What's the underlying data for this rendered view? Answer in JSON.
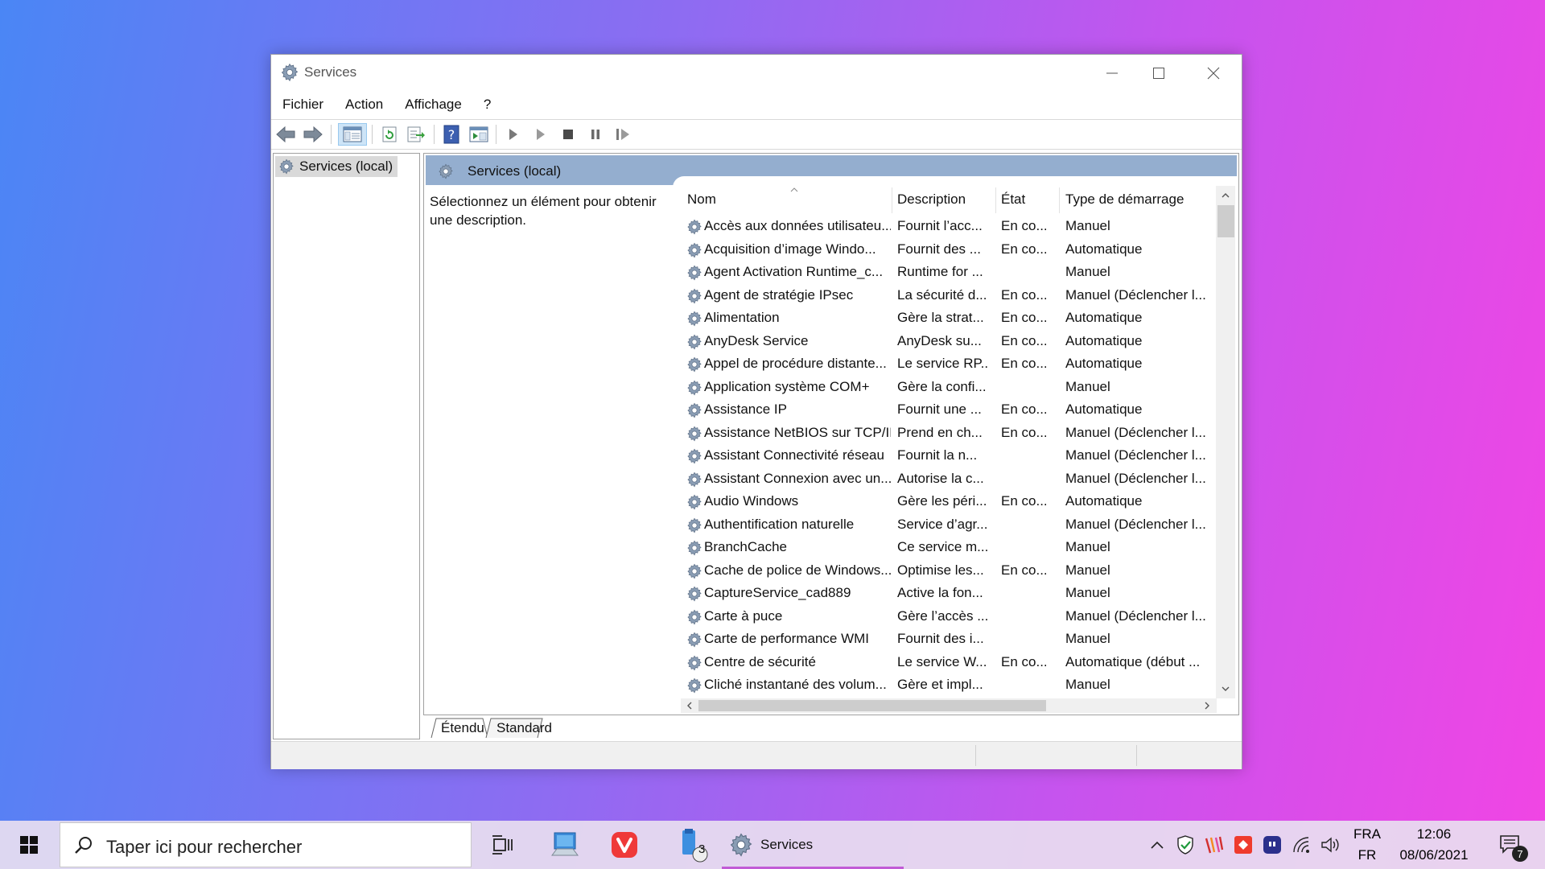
{
  "window": {
    "title": "Services"
  },
  "menu": [
    "Fichier",
    "Action",
    "Affichage",
    "?"
  ],
  "tree": {
    "root_label": "Services (local)"
  },
  "pane": {
    "header": "Services (local)",
    "description_prompt": "Sélectionnez un élément pour obtenir une description."
  },
  "columns": {
    "name": "Nom",
    "description": "Description",
    "state": "État",
    "startup": "Type de démarrage"
  },
  "services": [
    {
      "name": "Accès aux données utilisateu...",
      "desc": "Fournit l’acc...",
      "state": "En co...",
      "startup": "Manuel"
    },
    {
      "name": "Acquisition d’image Windo...",
      "desc": "Fournit des ...",
      "state": "En co...",
      "startup": "Automatique"
    },
    {
      "name": "Agent Activation Runtime_c...",
      "desc": "Runtime for ...",
      "state": "",
      "startup": "Manuel"
    },
    {
      "name": "Agent de stratégie IPsec",
      "desc": "La sécurité d...",
      "state": "En co...",
      "startup": "Manuel (Déclencher l..."
    },
    {
      "name": "Alimentation",
      "desc": "Gère la strat...",
      "state": "En co...",
      "startup": "Automatique"
    },
    {
      "name": "AnyDesk Service",
      "desc": "AnyDesk su...",
      "state": "En co...",
      "startup": "Automatique"
    },
    {
      "name": "Appel de procédure distante...",
      "desc": "Le service RP...",
      "state": "En co...",
      "startup": "Automatique"
    },
    {
      "name": "Application système COM+",
      "desc": "Gère la confi...",
      "state": "",
      "startup": "Manuel"
    },
    {
      "name": "Assistance IP",
      "desc": "Fournit une ...",
      "state": "En co...",
      "startup": "Automatique"
    },
    {
      "name": "Assistance NetBIOS sur TCP/IP",
      "desc": "Prend en ch...",
      "state": "En co...",
      "startup": "Manuel (Déclencher l..."
    },
    {
      "name": "Assistant Connectivité réseau",
      "desc": "Fournit la n...",
      "state": "",
      "startup": "Manuel (Déclencher l..."
    },
    {
      "name": "Assistant Connexion avec un...",
      "desc": "Autorise la c...",
      "state": "",
      "startup": "Manuel (Déclencher l..."
    },
    {
      "name": "Audio Windows",
      "desc": "Gère les péri...",
      "state": "En co...",
      "startup": "Automatique"
    },
    {
      "name": "Authentification naturelle",
      "desc": "Service d’agr...",
      "state": "",
      "startup": "Manuel (Déclencher l..."
    },
    {
      "name": "BranchCache",
      "desc": "Ce service m...",
      "state": "",
      "startup": "Manuel"
    },
    {
      "name": "Cache de police de Windows...",
      "desc": "Optimise les...",
      "state": "En co...",
      "startup": "Manuel"
    },
    {
      "name": "CaptureService_cad889",
      "desc": "Active la fon...",
      "state": "",
      "startup": "Manuel"
    },
    {
      "name": "Carte à puce",
      "desc": "Gère l’accès ...",
      "state": "",
      "startup": "Manuel (Déclencher l..."
    },
    {
      "name": "Carte de performance WMI",
      "desc": "Fournit des i...",
      "state": "",
      "startup": "Manuel"
    },
    {
      "name": "Centre de sécurité",
      "desc": "Le service W...",
      "state": "En co...",
      "startup": "Automatique (début ..."
    },
    {
      "name": "Cliché instantané des volum...",
      "desc": "Gère et impl...",
      "state": "",
      "startup": "Manuel"
    }
  ],
  "tabs": [
    "Étendu",
    "Standard"
  ],
  "taskbar": {
    "search_placeholder": "Taper ici pour rechercher",
    "files_badge": "3",
    "active_app_label": "Services",
    "lang_top": "FRA",
    "lang_bottom": "FR",
    "time": "12:06",
    "date": "08/06/2021",
    "notification_count": "7"
  },
  "colors": {
    "pane_header": "#94aecf",
    "taskbar_accent": "#c15bd6",
    "vivaldi_red": "#ef3939"
  }
}
